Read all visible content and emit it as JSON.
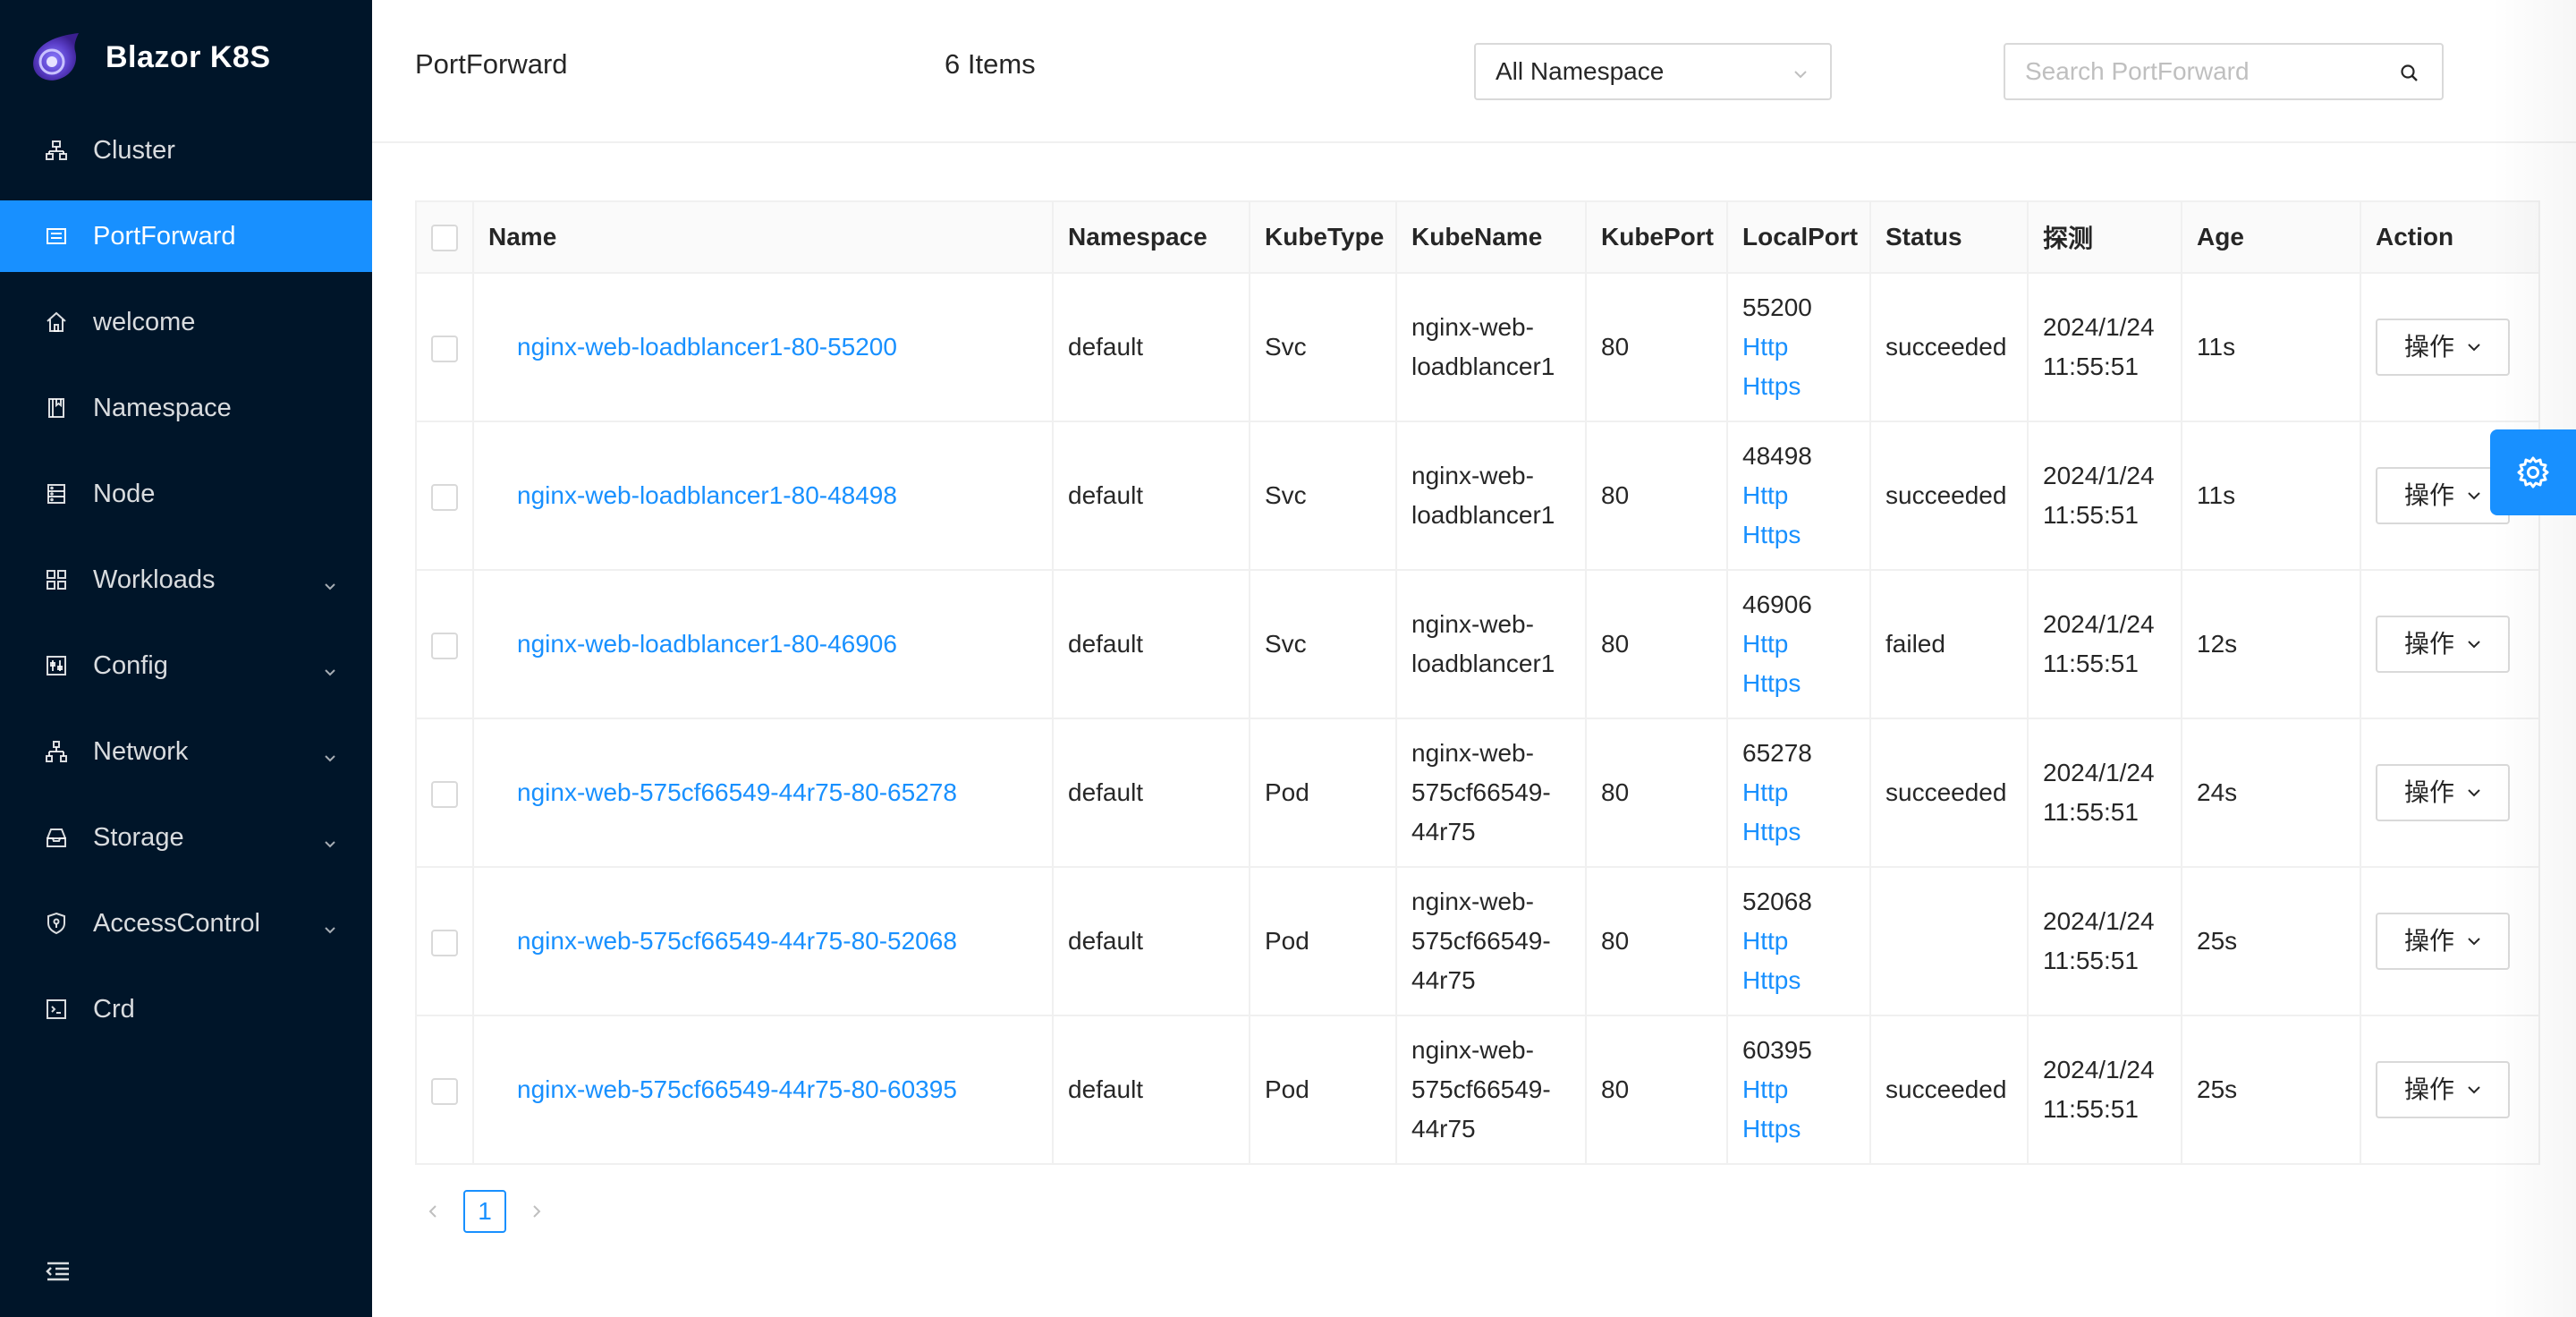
{
  "app": {
    "title": "Blazor K8S"
  },
  "colors": {
    "sidebar_bg": "#001529",
    "primary": "#1890ff"
  },
  "sidebar": {
    "items": [
      {
        "label": "Cluster",
        "icon": "cluster-icon",
        "expandable": false,
        "active": false
      },
      {
        "label": "PortForward",
        "icon": "list-icon",
        "expandable": false,
        "active": true
      },
      {
        "label": "welcome",
        "icon": "home-icon",
        "expandable": false,
        "active": false
      },
      {
        "label": "Namespace",
        "icon": "book-icon",
        "expandable": false,
        "active": false
      },
      {
        "label": "Node",
        "icon": "database-icon",
        "expandable": false,
        "active": false
      },
      {
        "label": "Workloads",
        "icon": "appstore-icon",
        "expandable": true,
        "active": false
      },
      {
        "label": "Config",
        "icon": "control-icon",
        "expandable": true,
        "active": false
      },
      {
        "label": "Network",
        "icon": "network-icon",
        "expandable": true,
        "active": false
      },
      {
        "label": "Storage",
        "icon": "inbox-icon",
        "expandable": true,
        "active": false
      },
      {
        "label": "AccessControl",
        "icon": "shield-icon",
        "expandable": true,
        "active": false
      },
      {
        "label": "Crd",
        "icon": "code-icon",
        "expandable": false,
        "active": false
      }
    ]
  },
  "header": {
    "title": "PortForward",
    "count": "6 Items",
    "namespace_select": "All Namespace",
    "search_placeholder": "Search PortForward"
  },
  "table": {
    "columns": [
      "Name",
      "Namespace",
      "KubeType",
      "KubeName",
      "KubePort",
      "LocalPort",
      "Status",
      "探测",
      "Age",
      "Action"
    ],
    "rows": [
      {
        "name": "nginx-web-loadblancer1-80-55200",
        "namespace": "default",
        "kubetype": "Svc",
        "kubename": [
          "nginx-web-",
          "loadblancer1"
        ],
        "kubeport": "80",
        "localport": "55200",
        "http": "Http",
        "https": "Https",
        "status": "succeeded",
        "probe": [
          "2024/1/24",
          "11:55:51"
        ],
        "age": "11s",
        "action": "操作"
      },
      {
        "name": "nginx-web-loadblancer1-80-48498",
        "namespace": "default",
        "kubetype": "Svc",
        "kubename": [
          "nginx-web-",
          "loadblancer1"
        ],
        "kubeport": "80",
        "localport": "48498",
        "http": "Http",
        "https": "Https",
        "status": "succeeded",
        "probe": [
          "2024/1/24",
          "11:55:51"
        ],
        "age": "11s",
        "action": "操作"
      },
      {
        "name": "nginx-web-loadblancer1-80-46906",
        "namespace": "default",
        "kubetype": "Svc",
        "kubename": [
          "nginx-web-",
          "loadblancer1"
        ],
        "kubeport": "80",
        "localport": "46906",
        "http": "Http",
        "https": "Https",
        "status": "failed",
        "probe": [
          "2024/1/24",
          "11:55:51"
        ],
        "age": "12s",
        "action": "操作"
      },
      {
        "name": "nginx-web-575cf66549-44r75-80-65278",
        "namespace": "default",
        "kubetype": "Pod",
        "kubename": [
          "nginx-web-",
          "575cf66549-",
          "44r75"
        ],
        "kubeport": "80",
        "localport": "65278",
        "http": "Http",
        "https": "Https",
        "status": "succeeded",
        "probe": [
          "2024/1/24",
          "11:55:51"
        ],
        "age": "24s",
        "action": "操作"
      },
      {
        "name": "nginx-web-575cf66549-44r75-80-52068",
        "namespace": "default",
        "kubetype": "Pod",
        "kubename": [
          "nginx-web-",
          "575cf66549-",
          "44r75"
        ],
        "kubeport": "80",
        "localport": "52068",
        "http": "Http",
        "https": "Https",
        "status": "",
        "probe": [
          "2024/1/24",
          "11:55:51"
        ],
        "age": "25s",
        "action": "操作"
      },
      {
        "name": "nginx-web-575cf66549-44r75-80-60395",
        "namespace": "default",
        "kubetype": "Pod",
        "kubename": [
          "nginx-web-",
          "575cf66549-",
          "44r75"
        ],
        "kubeport": "80",
        "localport": "60395",
        "http": "Http",
        "https": "Https",
        "status": "succeeded",
        "probe": [
          "2024/1/24",
          "11:55:51"
        ],
        "age": "25s",
        "action": "操作"
      }
    ]
  },
  "pagination": {
    "current": "1"
  }
}
